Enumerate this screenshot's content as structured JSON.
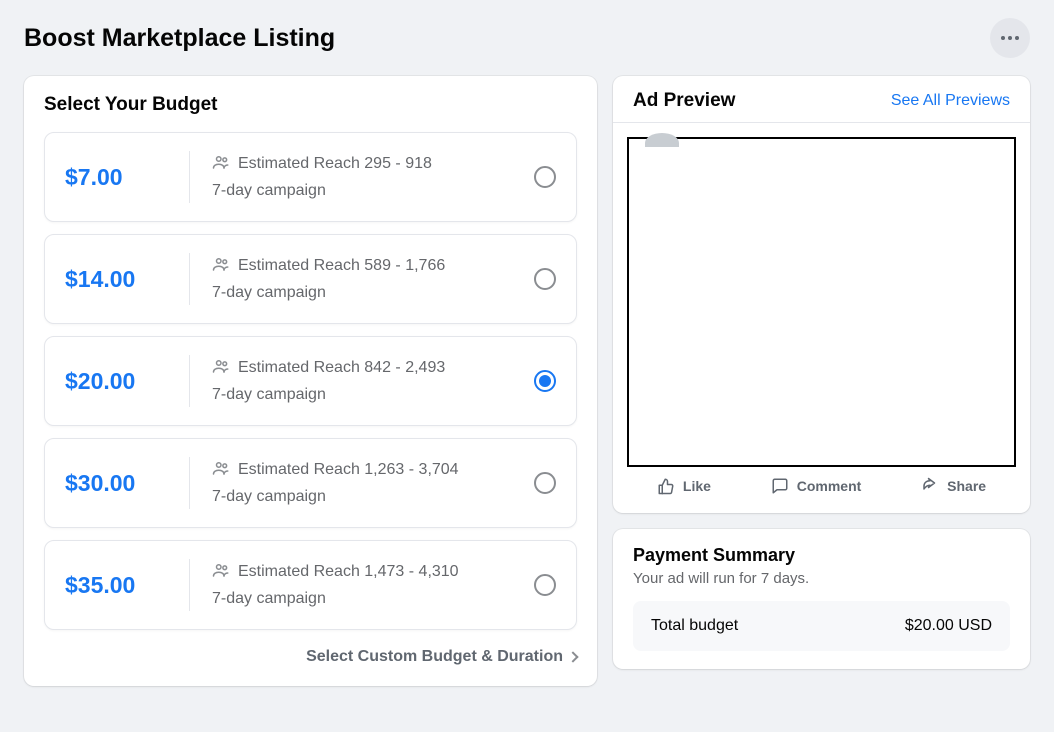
{
  "header": {
    "title": "Boost Marketplace Listing"
  },
  "budget": {
    "section_title": "Select Your Budget",
    "options": [
      {
        "price": "$7.00",
        "reach": "Estimated Reach 295 - 918",
        "duration": "7-day campaign",
        "selected": false
      },
      {
        "price": "$14.00",
        "reach": "Estimated Reach 589 - 1,766",
        "duration": "7-day campaign",
        "selected": false
      },
      {
        "price": "$20.00",
        "reach": "Estimated Reach 842 - 2,493",
        "duration": "7-day campaign",
        "selected": true
      },
      {
        "price": "$30.00",
        "reach": "Estimated Reach 1,263 - 3,704",
        "duration": "7-day campaign",
        "selected": false
      },
      {
        "price": "$35.00",
        "reach": "Estimated Reach 1,473 - 4,310",
        "duration": "7-day campaign",
        "selected": false
      }
    ],
    "custom_label": "Select Custom Budget & Duration"
  },
  "preview": {
    "title": "Ad Preview",
    "see_all": "See All Previews",
    "actions": {
      "like": "Like",
      "comment": "Comment",
      "share": "Share"
    }
  },
  "payment": {
    "title": "Payment Summary",
    "subtitle": "Your ad will run for 7 days.",
    "total_label": "Total budget",
    "total_value": "$20.00 USD"
  }
}
